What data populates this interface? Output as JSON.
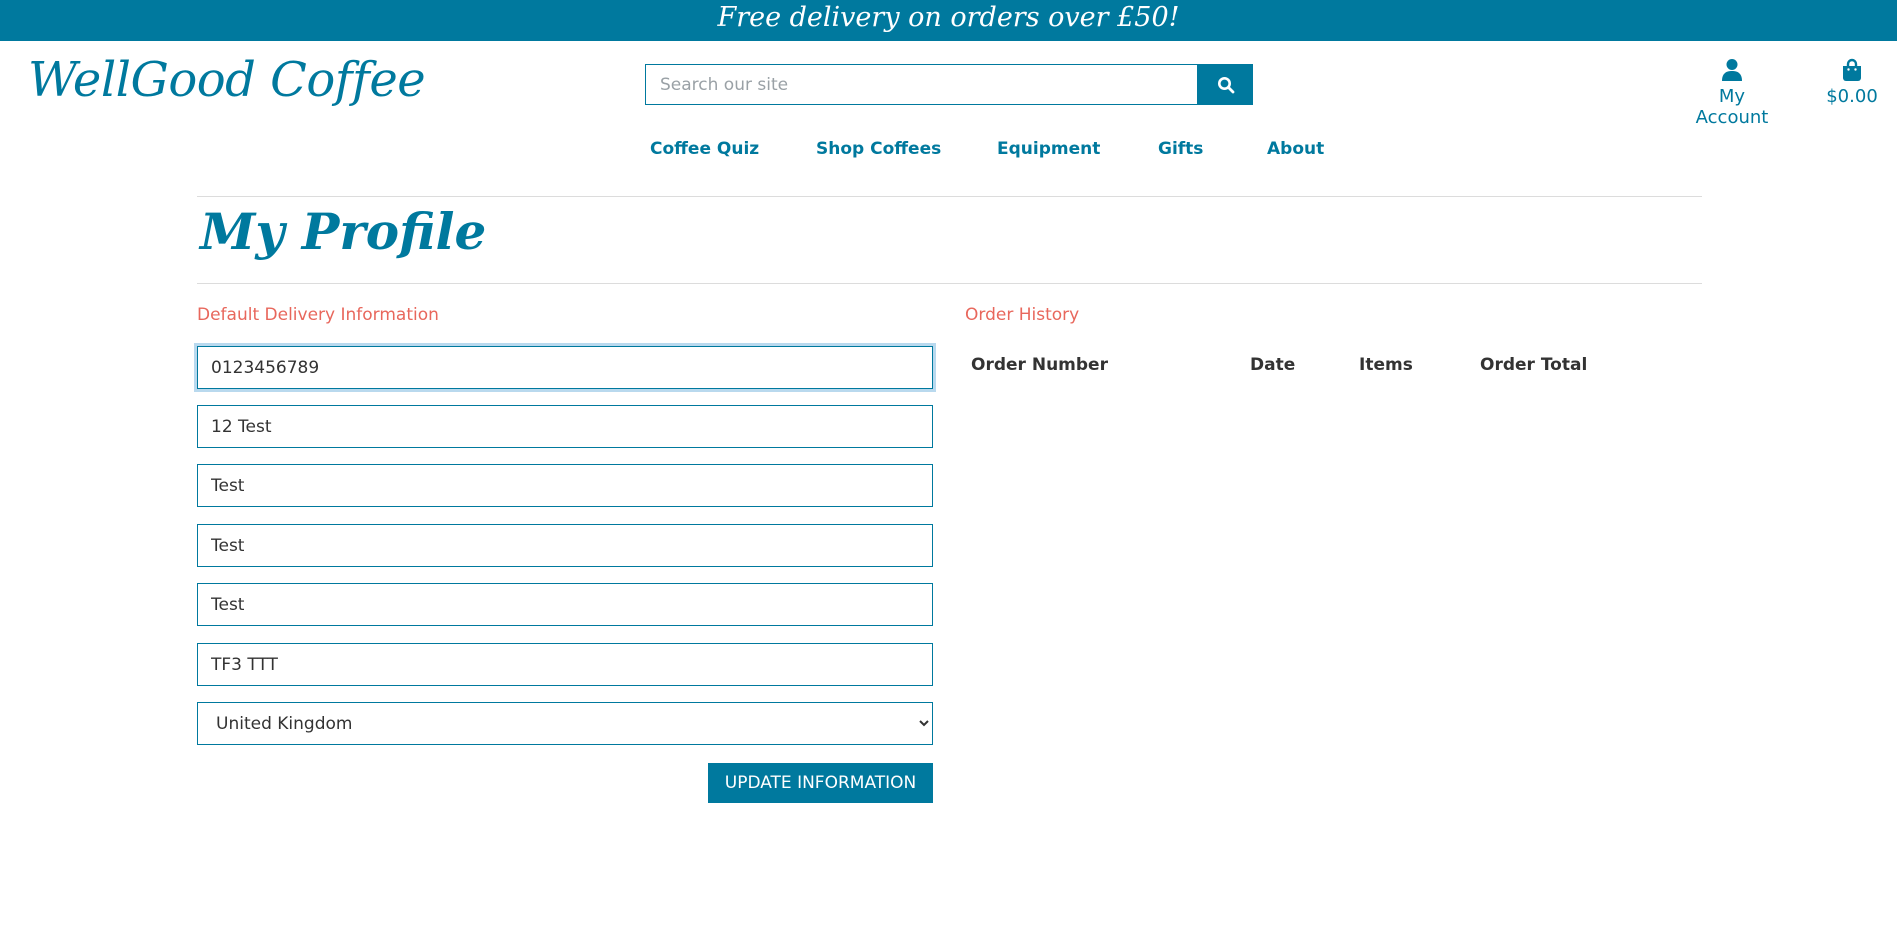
{
  "banner": {
    "text": "Free delivery on orders over £50!"
  },
  "brand": {
    "logo_text": "WellGood Coffee",
    "accent_color": "#00799e",
    "section_color": "#e8675c"
  },
  "search": {
    "placeholder": "Search our site",
    "value": "",
    "button_icon": "search-icon"
  },
  "header": {
    "account_label": "My Account",
    "account_icon": "user-icon",
    "cart_total": "$0.00",
    "cart_icon": "shopping-bag-icon"
  },
  "nav": {
    "items": [
      {
        "label": "Coffee Quiz"
      },
      {
        "label": "Shop Coffees"
      },
      {
        "label": "Equipment"
      },
      {
        "label": "Gifts"
      },
      {
        "label": "About"
      }
    ]
  },
  "page": {
    "title": "My Profile"
  },
  "delivery": {
    "heading": "Default Delivery Information",
    "fields": [
      {
        "value": "0123456789"
      },
      {
        "value": "12 Test"
      },
      {
        "value": "Test"
      },
      {
        "value": "Test"
      },
      {
        "value": "Test"
      },
      {
        "value": "TF3 TTT"
      }
    ],
    "country": {
      "selected": "United Kingdom"
    },
    "submit_label": "UPDATE INFORMATION"
  },
  "orders": {
    "heading": "Order History",
    "columns": [
      "Order Number",
      "Date",
      "Items",
      "Order Total"
    ],
    "rows": []
  }
}
